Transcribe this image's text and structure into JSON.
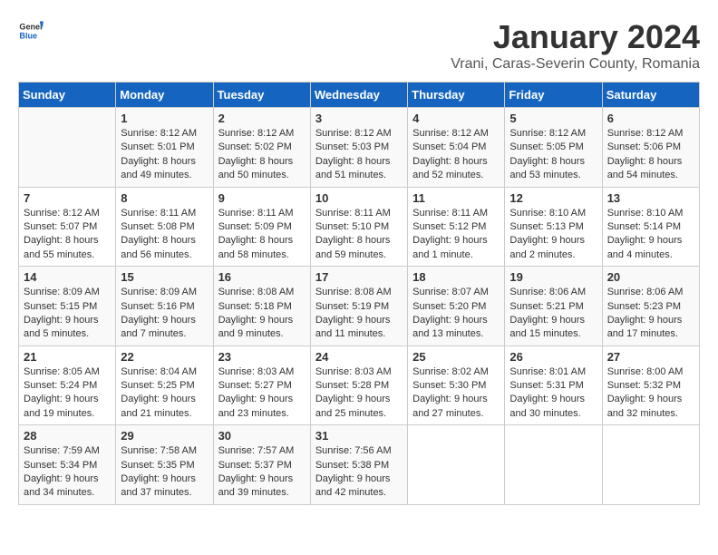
{
  "header": {
    "logo_general": "General",
    "logo_blue": "Blue",
    "month_title": "January 2024",
    "location": "Vrani, Caras-Severin County, Romania"
  },
  "calendar": {
    "days_of_week": [
      "Sunday",
      "Monday",
      "Tuesday",
      "Wednesday",
      "Thursday",
      "Friday",
      "Saturday"
    ],
    "weeks": [
      [
        {
          "day": "",
          "info": ""
        },
        {
          "day": "1",
          "info": "Sunrise: 8:12 AM\nSunset: 5:01 PM\nDaylight: 8 hours\nand 49 minutes."
        },
        {
          "day": "2",
          "info": "Sunrise: 8:12 AM\nSunset: 5:02 PM\nDaylight: 8 hours\nand 50 minutes."
        },
        {
          "day": "3",
          "info": "Sunrise: 8:12 AM\nSunset: 5:03 PM\nDaylight: 8 hours\nand 51 minutes."
        },
        {
          "day": "4",
          "info": "Sunrise: 8:12 AM\nSunset: 5:04 PM\nDaylight: 8 hours\nand 52 minutes."
        },
        {
          "day": "5",
          "info": "Sunrise: 8:12 AM\nSunset: 5:05 PM\nDaylight: 8 hours\nand 53 minutes."
        },
        {
          "day": "6",
          "info": "Sunrise: 8:12 AM\nSunset: 5:06 PM\nDaylight: 8 hours\nand 54 minutes."
        }
      ],
      [
        {
          "day": "7",
          "info": ""
        },
        {
          "day": "8",
          "info": "Sunrise: 8:11 AM\nSunset: 5:08 PM\nDaylight: 8 hours\nand 56 minutes."
        },
        {
          "day": "9",
          "info": "Sunrise: 8:11 AM\nSunset: 5:09 PM\nDaylight: 8 hours\nand 58 minutes."
        },
        {
          "day": "10",
          "info": "Sunrise: 8:11 AM\nSunset: 5:10 PM\nDaylight: 8 hours\nand 59 minutes."
        },
        {
          "day": "11",
          "info": "Sunrise: 8:11 AM\nSunset: 5:12 PM\nDaylight: 9 hours\nand 1 minute."
        },
        {
          "day": "12",
          "info": "Sunrise: 8:10 AM\nSunset: 5:13 PM\nDaylight: 9 hours\nand 2 minutes."
        },
        {
          "day": "13",
          "info": "Sunrise: 8:10 AM\nSunset: 5:14 PM\nDaylight: 9 hours\nand 4 minutes."
        }
      ],
      [
        {
          "day": "14",
          "info": ""
        },
        {
          "day": "15",
          "info": "Sunrise: 8:09 AM\nSunset: 5:16 PM\nDaylight: 9 hours\nand 7 minutes."
        },
        {
          "day": "16",
          "info": "Sunrise: 8:08 AM\nSunset: 5:18 PM\nDaylight: 9 hours\nand 9 minutes."
        },
        {
          "day": "17",
          "info": "Sunrise: 8:08 AM\nSunset: 5:19 PM\nDaylight: 9 hours\nand 11 minutes."
        },
        {
          "day": "18",
          "info": "Sunrise: 8:07 AM\nSunset: 5:20 PM\nDaylight: 9 hours\nand 13 minutes."
        },
        {
          "day": "19",
          "info": "Sunrise: 8:06 AM\nSunset: 5:21 PM\nDaylight: 9 hours\nand 15 minutes."
        },
        {
          "day": "20",
          "info": "Sunrise: 8:06 AM\nSunset: 5:23 PM\nDaylight: 9 hours\nand 17 minutes."
        }
      ],
      [
        {
          "day": "21",
          "info": ""
        },
        {
          "day": "22",
          "info": "Sunrise: 8:04 AM\nSunset: 5:25 PM\nDaylight: 9 hours\nand 21 minutes."
        },
        {
          "day": "23",
          "info": "Sunrise: 8:03 AM\nSunset: 5:27 PM\nDaylight: 9 hours\nand 23 minutes."
        },
        {
          "day": "24",
          "info": "Sunrise: 8:03 AM\nSunset: 5:28 PM\nDaylight: 9 hours\nand 25 minutes."
        },
        {
          "day": "25",
          "info": "Sunrise: 8:02 AM\nSunset: 5:30 PM\nDaylight: 9 hours\nand 27 minutes."
        },
        {
          "day": "26",
          "info": "Sunrise: 8:01 AM\nSunset: 5:31 PM\nDaylight: 9 hours\nand 30 minutes."
        },
        {
          "day": "27",
          "info": "Sunrise: 8:00 AM\nSunset: 5:32 PM\nDaylight: 9 hours\nand 32 minutes."
        }
      ],
      [
        {
          "day": "28",
          "info": ""
        },
        {
          "day": "29",
          "info": "Sunrise: 7:58 AM\nSunset: 5:35 PM\nDaylight: 9 hours\nand 37 minutes."
        },
        {
          "day": "30",
          "info": "Sunrise: 7:57 AM\nSunset: 5:37 PM\nDaylight: 9 hours\nand 39 minutes."
        },
        {
          "day": "31",
          "info": "Sunrise: 7:56 AM\nSunset: 5:38 PM\nDaylight: 9 hours\nand 42 minutes."
        },
        {
          "day": "",
          "info": ""
        },
        {
          "day": "",
          "info": ""
        },
        {
          "day": "",
          "info": ""
        }
      ]
    ],
    "week1_day7_info": "Sunrise: 8:12 AM\nSunset: 5:07 PM\nDaylight: 8 hours\nand 55 minutes.",
    "week2_day14_info": "Sunrise: 8:09 AM\nSunset: 5:15 PM\nDaylight: 9 hours\nand 5 minutes.",
    "week3_day21_info": "Sunrise: 8:05 AM\nSunset: 5:24 PM\nDaylight: 9 hours\nand 19 minutes.",
    "week4_day28_info": "Sunrise: 7:59 AM\nSunset: 5:34 PM\nDaylight: 9 hours\nand 34 minutes."
  }
}
